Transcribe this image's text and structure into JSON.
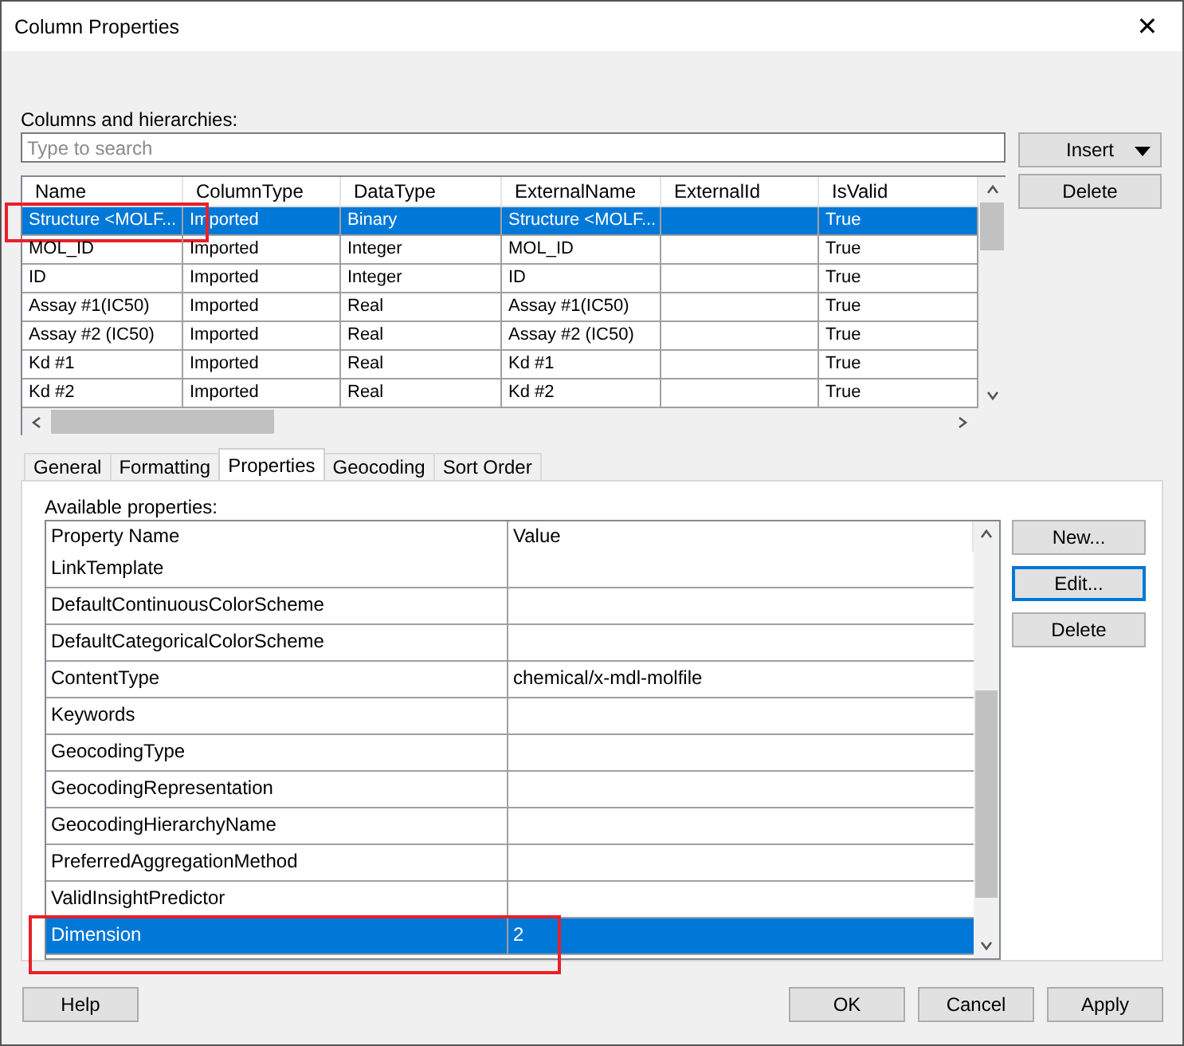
{
  "window": {
    "title": "Column Properties",
    "close": "✕"
  },
  "columns_label": "Columns and hierarchies:",
  "search": {
    "placeholder": "Type to search"
  },
  "side_buttons": [
    {
      "label": "Insert",
      "dropdown": true
    },
    {
      "label": "Delete",
      "dropdown": false
    }
  ],
  "columns_table": {
    "columns": [
      "Name",
      "ColumnType",
      "DataType",
      "ExternalName",
      "ExternalId",
      "IsValid"
    ],
    "rows": [
      {
        "cells": [
          "Structure <MOLF...",
          "Imported",
          "Binary",
          "Structure <MOLF...",
          "",
          "True"
        ],
        "selected": true,
        "marked": true
      },
      {
        "cells": [
          "MOL_ID",
          "Imported",
          "Integer",
          "MOL_ID",
          "",
          "True"
        ],
        "selected": false,
        "marked": false
      },
      {
        "cells": [
          "ID",
          "Imported",
          "Integer",
          "ID",
          "",
          "True"
        ],
        "selected": false,
        "marked": false
      },
      {
        "cells": [
          "Assay #1(IC50)",
          "Imported",
          "Real",
          "Assay #1(IC50)",
          "",
          "True"
        ],
        "selected": false,
        "marked": false
      },
      {
        "cells": [
          "Assay #2 (IC50)",
          "Imported",
          "Real",
          "Assay #2 (IC50)",
          "",
          "True"
        ],
        "selected": false,
        "marked": false
      },
      {
        "cells": [
          "Kd #1",
          "Imported",
          "Real",
          "Kd #1",
          "",
          "True"
        ],
        "selected": false,
        "marked": false
      },
      {
        "cells": [
          "Kd #2",
          "Imported",
          "Real",
          "Kd #2",
          "",
          "True"
        ],
        "selected": false,
        "marked": false
      }
    ]
  },
  "tabs": [
    {
      "label": "General",
      "selected": false
    },
    {
      "label": "Formatting",
      "selected": false
    },
    {
      "label": "Properties",
      "selected": true
    },
    {
      "label": "Geocoding",
      "selected": false
    },
    {
      "label": "Sort Order",
      "selected": false
    }
  ],
  "properties_label": "Available properties:",
  "properties_table": {
    "columns": [
      "Property Name",
      "Value"
    ],
    "rows": [
      {
        "name": "LinkTemplate",
        "value": "",
        "selected": false,
        "marked": false
      },
      {
        "name": "DefaultContinuousColorScheme",
        "value": "",
        "selected": false,
        "marked": false
      },
      {
        "name": "DefaultCategoricalColorScheme",
        "value": "",
        "selected": false,
        "marked": false
      },
      {
        "name": "ContentType",
        "value": "chemical/x-mdl-molfile",
        "selected": false,
        "marked": false
      },
      {
        "name": "Keywords",
        "value": "",
        "selected": false,
        "marked": false
      },
      {
        "name": "GeocodingType",
        "value": "",
        "selected": false,
        "marked": false
      },
      {
        "name": "GeocodingRepresentation",
        "value": "",
        "selected": false,
        "marked": false
      },
      {
        "name": "GeocodingHierarchyName",
        "value": "",
        "selected": false,
        "marked": false
      },
      {
        "name": "PreferredAggregationMethod",
        "value": "",
        "selected": false,
        "marked": false
      },
      {
        "name": "ValidInsightPredictor",
        "value": "",
        "selected": false,
        "marked": false
      },
      {
        "name": "Dimension",
        "value": "2",
        "selected": true,
        "marked": true
      }
    ]
  },
  "property_buttons": [
    {
      "label": "New...",
      "focused": false
    },
    {
      "label": "Edit...",
      "focused": true
    },
    {
      "label": "Delete",
      "focused": false
    }
  ],
  "footer_left": [
    {
      "label": "Help"
    }
  ],
  "footer_right": [
    {
      "label": "OK"
    },
    {
      "label": "Cancel"
    },
    {
      "label": "Apply"
    }
  ]
}
